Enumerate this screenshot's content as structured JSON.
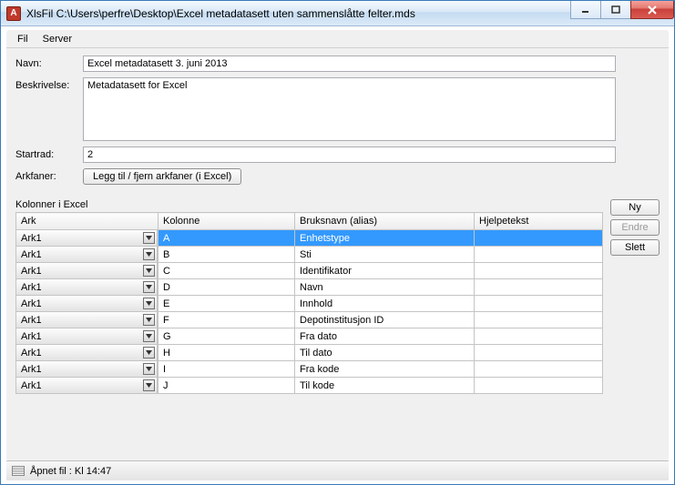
{
  "window": {
    "icon_letter": "A",
    "title": "XlsFil C:\\Users\\perfre\\Desktop\\Excel metadatasett uten sammenslåtte felter.mds"
  },
  "menubar": {
    "file": "Fil",
    "server": "Server"
  },
  "form": {
    "navn_label": "Navn:",
    "navn_value": "Excel metadatasett 3. juni 2013",
    "beskrivelse_label": "Beskrivelse:",
    "beskrivelse_value": "Metadatasett for Excel",
    "startrad_label": "Startrad:",
    "startrad_value": "2",
    "arkfaner_label": "Arkfaner:",
    "arkfaner_button": "Legg til / fjern arkfaner (i Excel)"
  },
  "grid": {
    "title": "Kolonner i Excel",
    "headers": {
      "ark": "Ark",
      "kolonne": "Kolonne",
      "bruksnavn": "Bruksnavn (alias)",
      "hjelpetekst": "Hjelpetekst"
    },
    "rows": [
      {
        "ark": "Ark1",
        "kolonne": "A",
        "bruksnavn": "Enhetstype",
        "hjelpetekst": "",
        "selected": true
      },
      {
        "ark": "Ark1",
        "kolonne": "B",
        "bruksnavn": "Sti",
        "hjelpetekst": ""
      },
      {
        "ark": "Ark1",
        "kolonne": "C",
        "bruksnavn": "Identifikator",
        "hjelpetekst": ""
      },
      {
        "ark": "Ark1",
        "kolonne": "D",
        "bruksnavn": "Navn",
        "hjelpetekst": ""
      },
      {
        "ark": "Ark1",
        "kolonne": "E",
        "bruksnavn": "Innhold",
        "hjelpetekst": ""
      },
      {
        "ark": "Ark1",
        "kolonne": "F",
        "bruksnavn": "Depotinstitusjon ID",
        "hjelpetekst": ""
      },
      {
        "ark": "Ark1",
        "kolonne": "G",
        "bruksnavn": "Fra dato",
        "hjelpetekst": ""
      },
      {
        "ark": "Ark1",
        "kolonne": "H",
        "bruksnavn": "Til dato",
        "hjelpetekst": ""
      },
      {
        "ark": "Ark1",
        "kolonne": "I",
        "bruksnavn": "Fra kode",
        "hjelpetekst": ""
      },
      {
        "ark": "Ark1",
        "kolonne": "J",
        "bruksnavn": "Til kode",
        "hjelpetekst": ""
      }
    ]
  },
  "actions": {
    "ny": "Ny",
    "endre": "Endre",
    "slett": "Slett"
  },
  "statusbar": {
    "text": "Åpnet fil :  Kl 14:47"
  }
}
